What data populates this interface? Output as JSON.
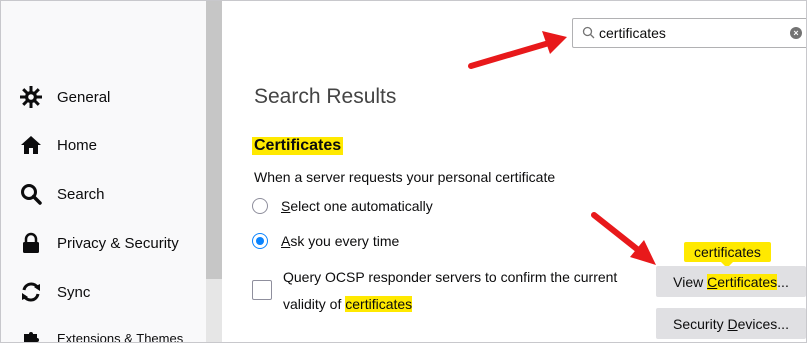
{
  "search": {
    "value": "certificates"
  },
  "sidebar": {
    "items": [
      {
        "label": "General",
        "icon": "gear-icon"
      },
      {
        "label": "Home",
        "icon": "home-icon"
      },
      {
        "label": "Search",
        "icon": "search-icon"
      },
      {
        "label": "Privacy & Security",
        "icon": "lock-icon"
      },
      {
        "label": "Sync",
        "icon": "sync-icon"
      },
      {
        "label": "Extensions & Themes",
        "icon": "puzzle-icon"
      }
    ]
  },
  "main": {
    "heading": "Search Results",
    "section_title": "Certificates",
    "description": "When a server requests your personal certificate",
    "radio_auto": {
      "accesskey": "S",
      "rest": "elect one automatically",
      "selected": false
    },
    "radio_ask": {
      "accesskey": "A",
      "rest": "sk you every time",
      "selected": true
    },
    "ocsp_line1": "Query OCSP responder servers to confirm the current",
    "ocsp_line2_prefix": "validity of ",
    "ocsp_line2_hl": "certificates",
    "tooltip": "certificates",
    "view_btn": {
      "prefix": "View ",
      "accesskey": "C",
      "hl_rest": "ertificates",
      "suffix": "..."
    },
    "devices_btn": {
      "prefix": "Security ",
      "accesskey": "D",
      "rest": "evices..."
    }
  },
  "colors": {
    "highlight": "#ffe900",
    "accent": "#0a84ff",
    "annotation_arrow": "#e8191b"
  }
}
